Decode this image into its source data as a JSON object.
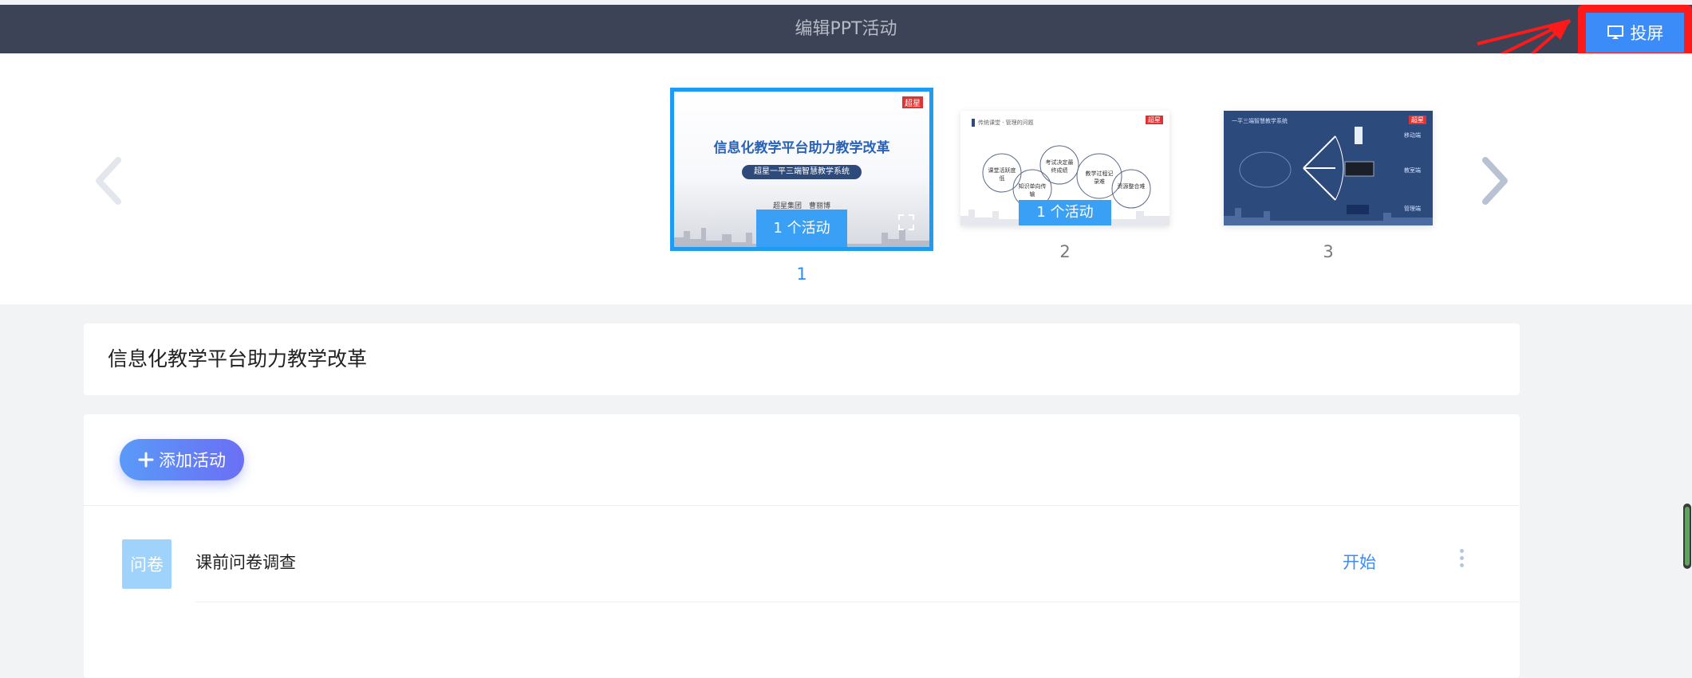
{
  "header": {
    "title": "编辑PPT活动",
    "cast_label": "投屏"
  },
  "slides": [
    {
      "number": "1",
      "activity_badge": "1 个活动",
      "main_title": "信息化教学平台助力教学改革",
      "subtitle": "超星一平三端智慧教学系统",
      "authors": "超星集团　曹丽博",
      "logo_text": "超星",
      "active": true
    },
    {
      "number": "2",
      "activity_badge": "1 个活动",
      "header_text": "传统课堂 · 管理的问题",
      "logo_text": "超星",
      "bubbles": [
        "课堂活跃度低",
        "知识单向传输",
        "考试决定最终成绩",
        "教学过程记录难",
        "资源整合难"
      ]
    },
    {
      "number": "3",
      "header_text": "一平三端智慧教学系统",
      "logo_text": "超星",
      "labels": [
        "移动端",
        "教室端",
        "管理端"
      ]
    }
  ],
  "course": {
    "title": "信息化教学平台助力教学改革"
  },
  "activities": {
    "add_label": "添加活动",
    "items": [
      {
        "type_badge": "问卷",
        "name": "课前问卷调查",
        "action": "开始"
      }
    ]
  },
  "icons": {
    "cast": "monitor-icon",
    "add": "plus-icon",
    "prev": "chevron-left-icon",
    "next": "chevron-right-icon",
    "fullscreen": "fullscreen-icon",
    "more": "more-vertical-icon"
  },
  "colors": {
    "header_bg": "#3d4356",
    "accent": "#3b8cf8",
    "highlight": "#ff1a1a"
  }
}
